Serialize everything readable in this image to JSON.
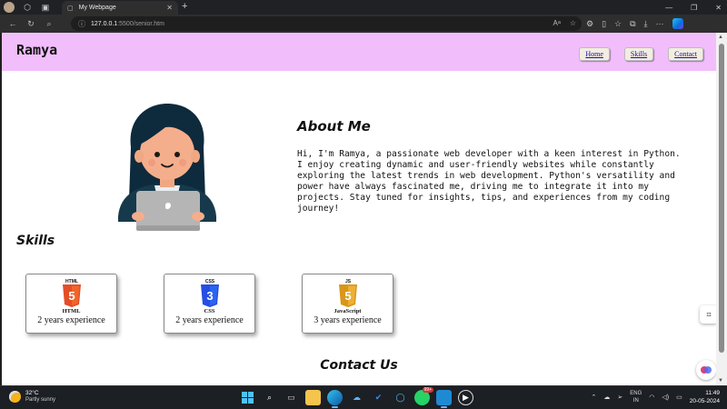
{
  "browser": {
    "tab_title": "My Webpage",
    "address_host": "127.0.0.1",
    "address_path": ":5500/senior.htm"
  },
  "site": {
    "brand": "Ramya",
    "nav": [
      {
        "label": "Home"
      },
      {
        "label": "Skills"
      },
      {
        "label": "Contact"
      }
    ],
    "about": {
      "title": "About Me",
      "text": "Hi, I'm Ramya, a passionate web developer with a keen interest in Python. I enjoy creating dynamic and user-friendly websites while constantly exploring the latest trends in web development. Python's versatility and power have always fascinated me, driving me to integrate it into my projects. Stay tuned for insights, tips, and experiences from my coding journey!"
    },
    "skills": {
      "title": "Skills",
      "items": [
        {
          "badge": "HTML",
          "name": "HTML",
          "experience": "2 years experience",
          "color": "#e44d26"
        },
        {
          "badge": "CSS",
          "name": "CSS",
          "experience": "2 years experience",
          "color": "#264de4"
        },
        {
          "badge": "JS",
          "name": "JavaScript",
          "experience": "3 years experience",
          "color": "#e8a31e"
        }
      ]
    },
    "contact": {
      "title": "Contact Us"
    },
    "colors": {
      "header_bg": "#f1befb"
    }
  },
  "taskbar": {
    "weather_temp": "32°C",
    "weather_condition": "Partly sunny",
    "lang_primary": "ENG",
    "lang_secondary": "IN",
    "time": "11:49",
    "date": "20-05-2024",
    "notification_badge": "99+"
  }
}
